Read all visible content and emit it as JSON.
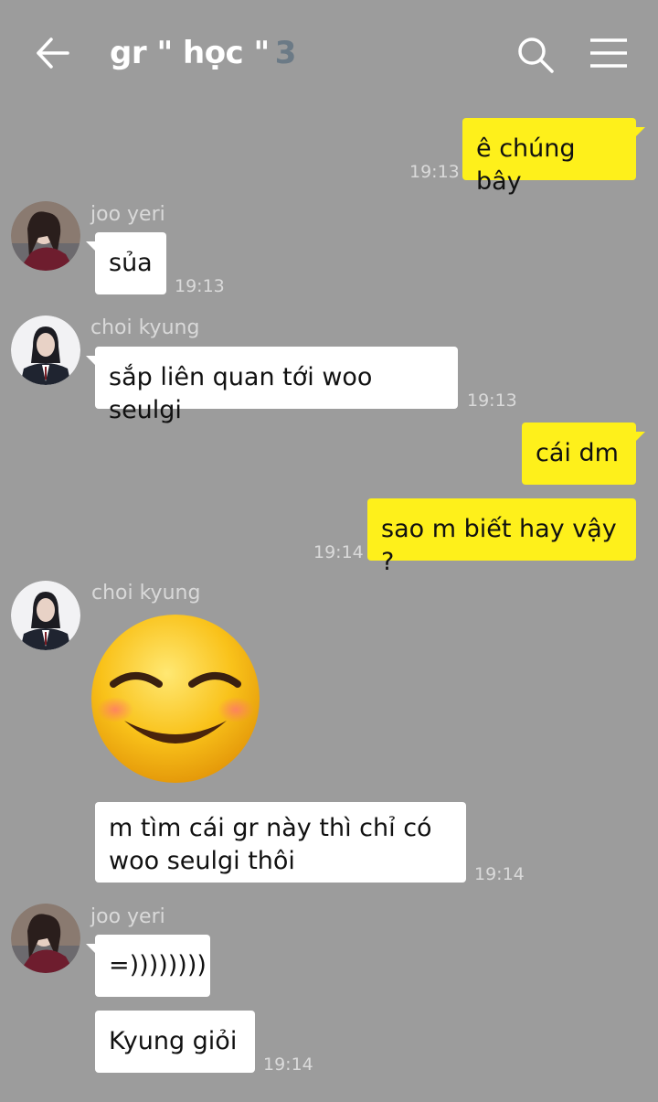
{
  "header": {
    "title": "gr \" học \"",
    "member_count": "3",
    "back_icon": "arrow-left-icon",
    "search_icon": "search-icon",
    "menu_icon": "hamburger-menu-icon"
  },
  "colors": {
    "background": "#9c9c9c",
    "outgoing_bubble": "#fef01b",
    "incoming_bubble": "#ffffff"
  },
  "messages": [
    {
      "sender": "",
      "text": "ê chúng bây",
      "time": "19:13"
    },
    {
      "sender": "joo yeri",
      "text": "sủa",
      "time": "19:13"
    },
    {
      "sender": "choi kyung",
      "text": "sắp liên quan tới woo seulgi",
      "time": "19:13"
    },
    {
      "sender": "",
      "text": "cái dm",
      "time": ""
    },
    {
      "sender": "",
      "text": "sao m biết hay vậy ?",
      "time": "19:14"
    },
    {
      "sender": "choi kyung",
      "text": "",
      "sticker": "relieved-face-emoji",
      "time": ""
    },
    {
      "sender": "",
      "text": "m tìm cái gr này thì chỉ có\nwoo seulgi thôi",
      "time": "19:14"
    },
    {
      "sender": "joo yeri",
      "text": "=))))))))",
      "time": ""
    },
    {
      "sender": "",
      "text": "Kyung giỏi",
      "time": "19:14"
    }
  ]
}
